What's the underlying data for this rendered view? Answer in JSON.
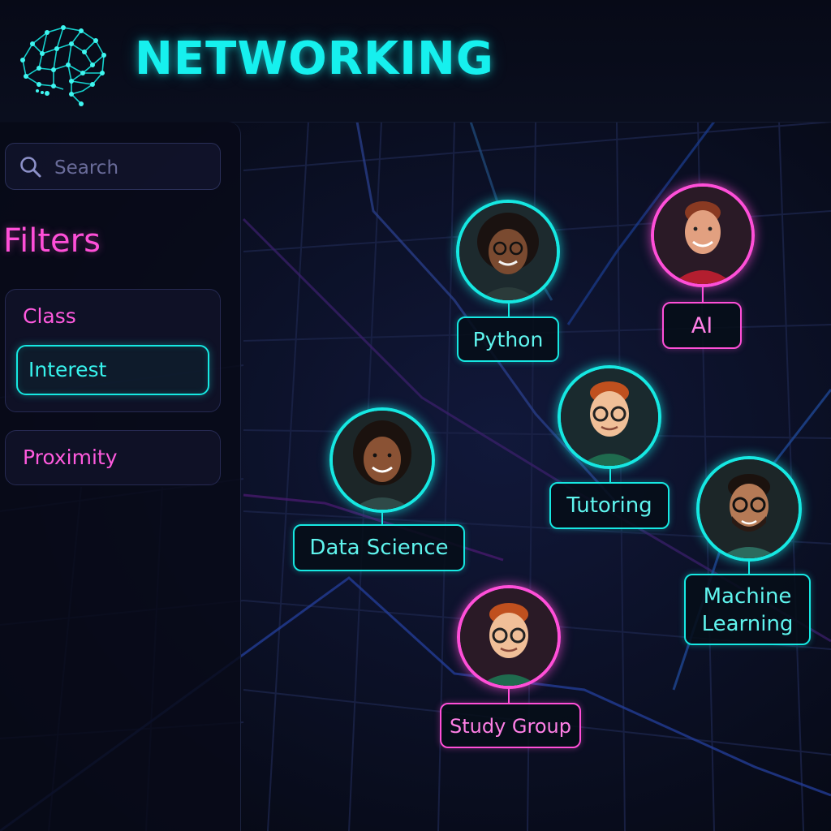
{
  "app": {
    "title": "NETWORKING",
    "logo_icon": "brain-network-icon"
  },
  "search": {
    "placeholder": "Search",
    "icon": "search-icon"
  },
  "filters": {
    "heading": "Filters",
    "items": [
      {
        "label": "Class",
        "selected": false
      },
      {
        "label": "Interest",
        "selected": true
      },
      {
        "label": "Proximity",
        "selected": false
      }
    ]
  },
  "nodes": [
    {
      "label": "Python",
      "color": "#16e8e2"
    },
    {
      "label": "AI",
      "color": "#ff4fd8"
    },
    {
      "label": "Tutoring",
      "color": "#16e8e2"
    },
    {
      "label": "Data Science",
      "color": "#16e8e2"
    },
    {
      "label": "Machine Learning",
      "label_lines": [
        "Machine",
        "Learning"
      ],
      "color": "#16e8e2"
    },
    {
      "label": "Study Group",
      "color": "#ff4fd8"
    }
  ],
  "colors": {
    "accent_cyan": "#16e8e2",
    "accent_pink": "#ff4fd8",
    "background": "#070b18"
  }
}
